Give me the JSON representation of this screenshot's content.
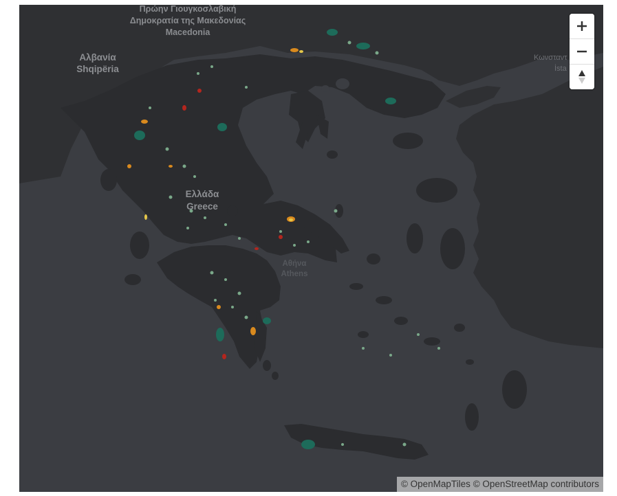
{
  "map": {
    "labels": {
      "north_macedonia_line1": "Πρώην Γιουγκοσλαβική",
      "north_macedonia_line2": "Δημοκρατία της Μακεδονίας",
      "north_macedonia_line3": "Macedonia",
      "albania_native": "Αλβανία",
      "albania_local": "Shqipëria",
      "greece_native": "Ελλάδα",
      "greece_en": "Greece",
      "athens_native": "Αθήνα",
      "athens_en": "Athens",
      "istanbul_partial_1": "Κωνσταντ",
      "istanbul_partial_2": "İsta"
    },
    "colors": {
      "sea": "#3b3d42",
      "land": "#2b2c2f",
      "foreign_land": "#2f3033",
      "feature_green": "#1d6b5a",
      "feature_light": "#7aa889",
      "feature_orange": "#d98a1e",
      "feature_red": "#b3261e",
      "feature_yellow": "#e6c84a"
    }
  },
  "controls": {
    "zoom_in_icon": "plus-icon",
    "zoom_out_icon": "minus-icon",
    "reset_bearing_icon": "compass-icon"
  },
  "attribution": {
    "openmaptiles": "© OpenMapTiles",
    "openstreetmap": "© OpenStreetMap contributors"
  }
}
